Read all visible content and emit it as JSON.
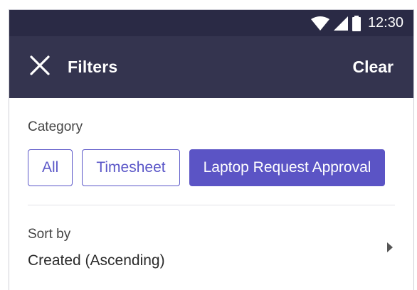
{
  "status_bar": {
    "time": "12:30",
    "icons": [
      "wifi-icon",
      "signal-icon",
      "battery-icon"
    ]
  },
  "app_bar": {
    "close_icon": "close-icon",
    "title": "Filters",
    "clear_label": "Clear"
  },
  "category": {
    "label": "Category",
    "chips": [
      {
        "label": "All",
        "selected": false
      },
      {
        "label": "Timesheet",
        "selected": false
      },
      {
        "label": "Laptop Request Approval",
        "selected": true
      }
    ]
  },
  "sort": {
    "label": "Sort by",
    "value": "Created (Ascending)",
    "chevron_icon": "chevron-right-icon"
  },
  "colors": {
    "status_bar": "#2a2a45",
    "app_bar": "#34344f",
    "accent": "#5b54c5"
  }
}
